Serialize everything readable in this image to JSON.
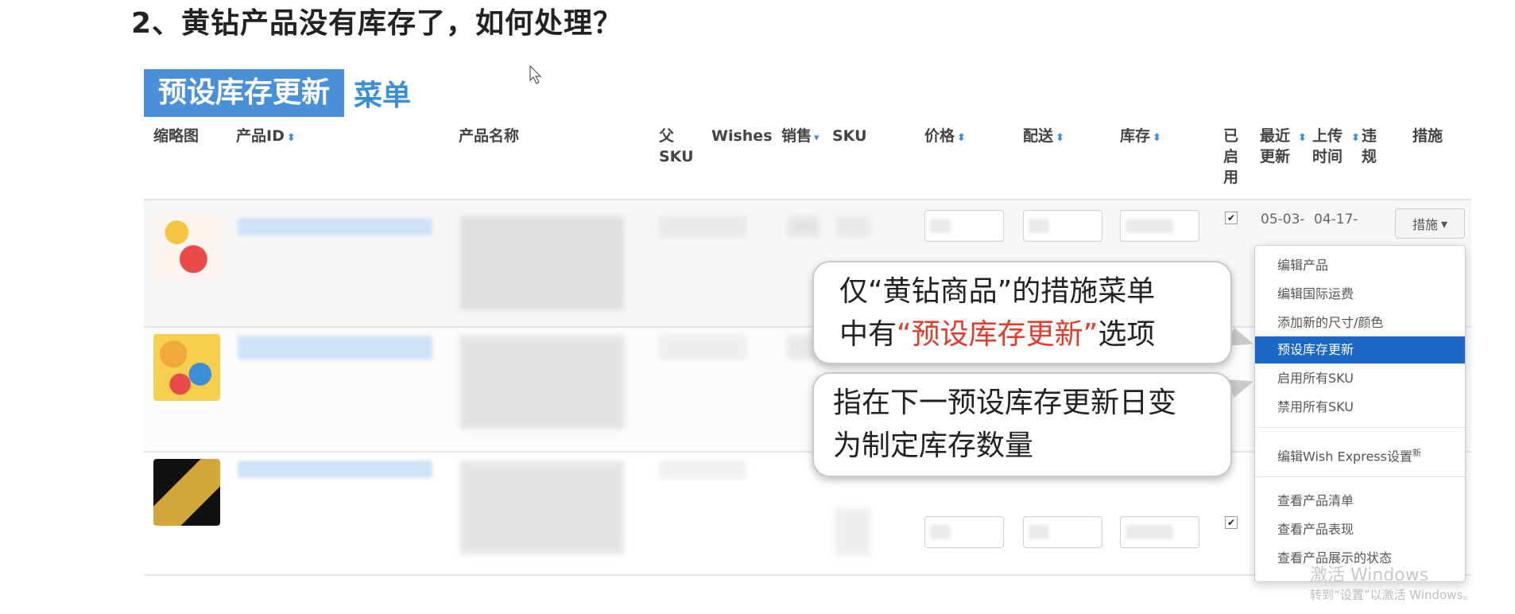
{
  "slide_title": "2、黄钻产品没有库存了，如何处理？",
  "menu_label": {
    "tag": "预设库存更新",
    "suffix": "菜单"
  },
  "columns": {
    "thumbnail": "缩略图",
    "product_id": "产品ID",
    "product_name": "产品名称",
    "parent_sku": "父 SKU",
    "wishes": "Wishes",
    "sales": "销售",
    "sku": "SKU",
    "price": "价格",
    "shipping": "配送",
    "inventory": "库存",
    "enabled": "已启用",
    "last_updated": "最近更新",
    "upload_time": "上传时间",
    "violation": "违规",
    "actions": "措施"
  },
  "rows": [
    {
      "last_updated": "05-03-",
      "upload_time": "04-17-",
      "enabled": true
    },
    {
      "enabled": false
    },
    {
      "enabled": true
    }
  ],
  "action_button": "措施",
  "dropdown": {
    "items": [
      {
        "label": "编辑产品"
      },
      {
        "label": "编辑国际运费"
      },
      {
        "label": "添加新的尺寸/颜色"
      },
      {
        "label": "预设库存更新",
        "active": true
      },
      {
        "label": "启用所有SKU"
      },
      {
        "label": "禁用所有SKU"
      },
      {
        "label": "编辑Wish Express设置",
        "sup": "新"
      },
      {
        "label": "查看产品清单"
      },
      {
        "label": "查看产品表现"
      },
      {
        "label": "查看产品展示的状态"
      }
    ]
  },
  "callouts": {
    "first": {
      "prefix": "仅“黄钻商品”的措施菜单",
      "line2_start": "中有",
      "highlight": "“预设库存更新”",
      "line2_end": "选项"
    },
    "second": {
      "line1": "指在下一预设库存更新日变",
      "line2": "为制定库存数量"
    }
  },
  "colors": {
    "accent": "#4a90d9",
    "active": "#1a67c7",
    "highlight": "#e23b2b"
  },
  "watermark": {
    "line1": "激活 Windows",
    "line2": "转到“设置”以激活 Windows。"
  }
}
